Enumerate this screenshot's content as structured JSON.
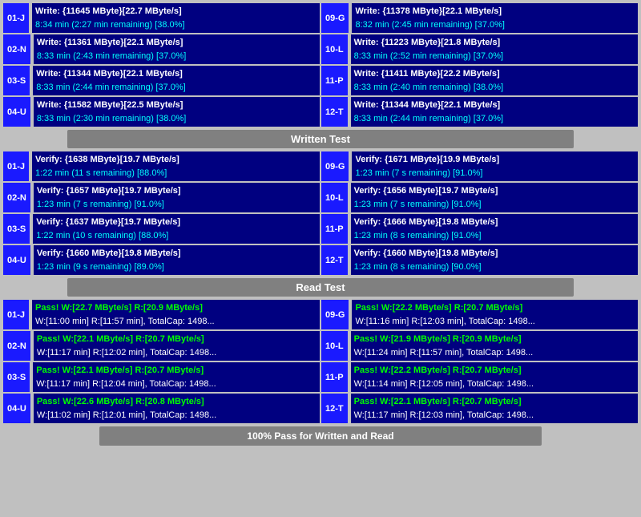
{
  "sections": {
    "written_test": {
      "label": "Written Test",
      "rows_left": [
        {
          "id": "01-J",
          "line1": "Write: {11645 MByte}[22.7 MByte/s]",
          "line2": "8:34 min (2:27 min remaining)  [38.0%]"
        },
        {
          "id": "02-N",
          "line1": "Write: {11361 MByte}[22.1 MByte/s]",
          "line2": "8:33 min (2:43 min remaining)  [37.0%]"
        },
        {
          "id": "03-S",
          "line1": "Write: {11344 MByte}[22.1 MByte/s]",
          "line2": "8:33 min (2:44 min remaining)  [37.0%]"
        },
        {
          "id": "04-U",
          "line1": "Write: {11582 MByte}[22.5 MByte/s]",
          "line2": "8:33 min (2:30 min remaining)  [38.0%]"
        }
      ],
      "rows_right": [
        {
          "id": "09-G",
          "line1": "Write: {11378 MByte}[22.1 MByte/s]",
          "line2": "8:32 min (2:45 min remaining)  [37.0%]"
        },
        {
          "id": "10-L",
          "line1": "Write: {11223 MByte}[21.8 MByte/s]",
          "line2": "8:33 min (2:52 min remaining)  [37.0%]"
        },
        {
          "id": "11-P",
          "line1": "Write: {11411 MByte}[22.2 MByte/s]",
          "line2": "8:33 min (2:40 min remaining)  [38.0%]"
        },
        {
          "id": "12-T",
          "line1": "Write: {11344 MByte}[22.1 MByte/s]",
          "line2": "8:33 min (2:44 min remaining)  [37.0%]"
        }
      ]
    },
    "verify_test": {
      "label": "Written Test",
      "rows_left": [
        {
          "id": "01-J",
          "line1": "Verify: {1638 MByte}[19.7 MByte/s]",
          "line2": "1:22 min (11 s remaining)  [88.0%]"
        },
        {
          "id": "02-N",
          "line1": "Verify: {1657 MByte}[19.7 MByte/s]",
          "line2": "1:23 min (7 s remaining)  [91.0%]"
        },
        {
          "id": "03-S",
          "line1": "Verify: {1637 MByte}[19.7 MByte/s]",
          "line2": "1:22 min (10 s remaining)  [88.0%]"
        },
        {
          "id": "04-U",
          "line1": "Verify: {1660 MByte}[19.8 MByte/s]",
          "line2": "1:23 min (9 s remaining)  [89.0%]"
        }
      ],
      "rows_right": [
        {
          "id": "09-G",
          "line1": "Verify: {1671 MByte}[19.9 MByte/s]",
          "line2": "1:23 min (7 s remaining)  [91.0%]"
        },
        {
          "id": "10-L",
          "line1": "Verify: {1656 MByte}[19.7 MByte/s]",
          "line2": "1:23 min (7 s remaining)  [91.0%]"
        },
        {
          "id": "11-P",
          "line1": "Verify: {1666 MByte}[19.8 MByte/s]",
          "line2": "1:23 min (8 s remaining)  [91.0%]"
        },
        {
          "id": "12-T",
          "line1": "Verify: {1660 MByte}[19.8 MByte/s]",
          "line2": "1:23 min (8 s remaining)  [90.0%]"
        }
      ]
    },
    "read_test": {
      "label": "Read Test",
      "rows_left": [
        {
          "id": "01-J",
          "line1": "Pass! W:[22.7 MByte/s] R:[20.9 MByte/s]",
          "line2": "W:[11:00 min] R:[11:57 min], TotalCap: 1498..."
        },
        {
          "id": "02-N",
          "line1": "Pass! W:[22.1 MByte/s] R:[20.7 MByte/s]",
          "line2": "W:[11:17 min] R:[12:02 min], TotalCap: 1498..."
        },
        {
          "id": "03-S",
          "line1": "Pass! W:[22.1 MByte/s] R:[20.7 MByte/s]",
          "line2": "W:[11:17 min] R:[12:04 min], TotalCap: 1498..."
        },
        {
          "id": "04-U",
          "line1": "Pass! W:[22.6 MByte/s] R:[20.8 MByte/s]",
          "line2": "W:[11:02 min] R:[12:01 min], TotalCap: 1498..."
        }
      ],
      "rows_right": [
        {
          "id": "09-G",
          "line1": "Pass! W:[22.2 MByte/s] R:[20.7 MByte/s]",
          "line2": "W:[11:16 min] R:[12:03 min], TotalCap: 1498..."
        },
        {
          "id": "10-L",
          "line1": "Pass! W:[21.9 MByte/s] R:[20.9 MByte/s]",
          "line2": "W:[11:24 min] R:[11:57 min], TotalCap: 1498..."
        },
        {
          "id": "11-P",
          "line1": "Pass! W:[22.2 MByte/s] R:[20.7 MByte/s]",
          "line2": "W:[11:14 min] R:[12:05 min], TotalCap: 1498..."
        },
        {
          "id": "12-T",
          "line1": "Pass! W:[22.1 MByte/s] R:[20.7 MByte/s]",
          "line2": "W:[11:17 min] R:[12:03 min], TotalCap: 1498..."
        }
      ]
    }
  },
  "headers": {
    "written_test": "Written Test",
    "read_test": "Read Test",
    "bottom_bar": "100% Pass for Written and Read"
  }
}
